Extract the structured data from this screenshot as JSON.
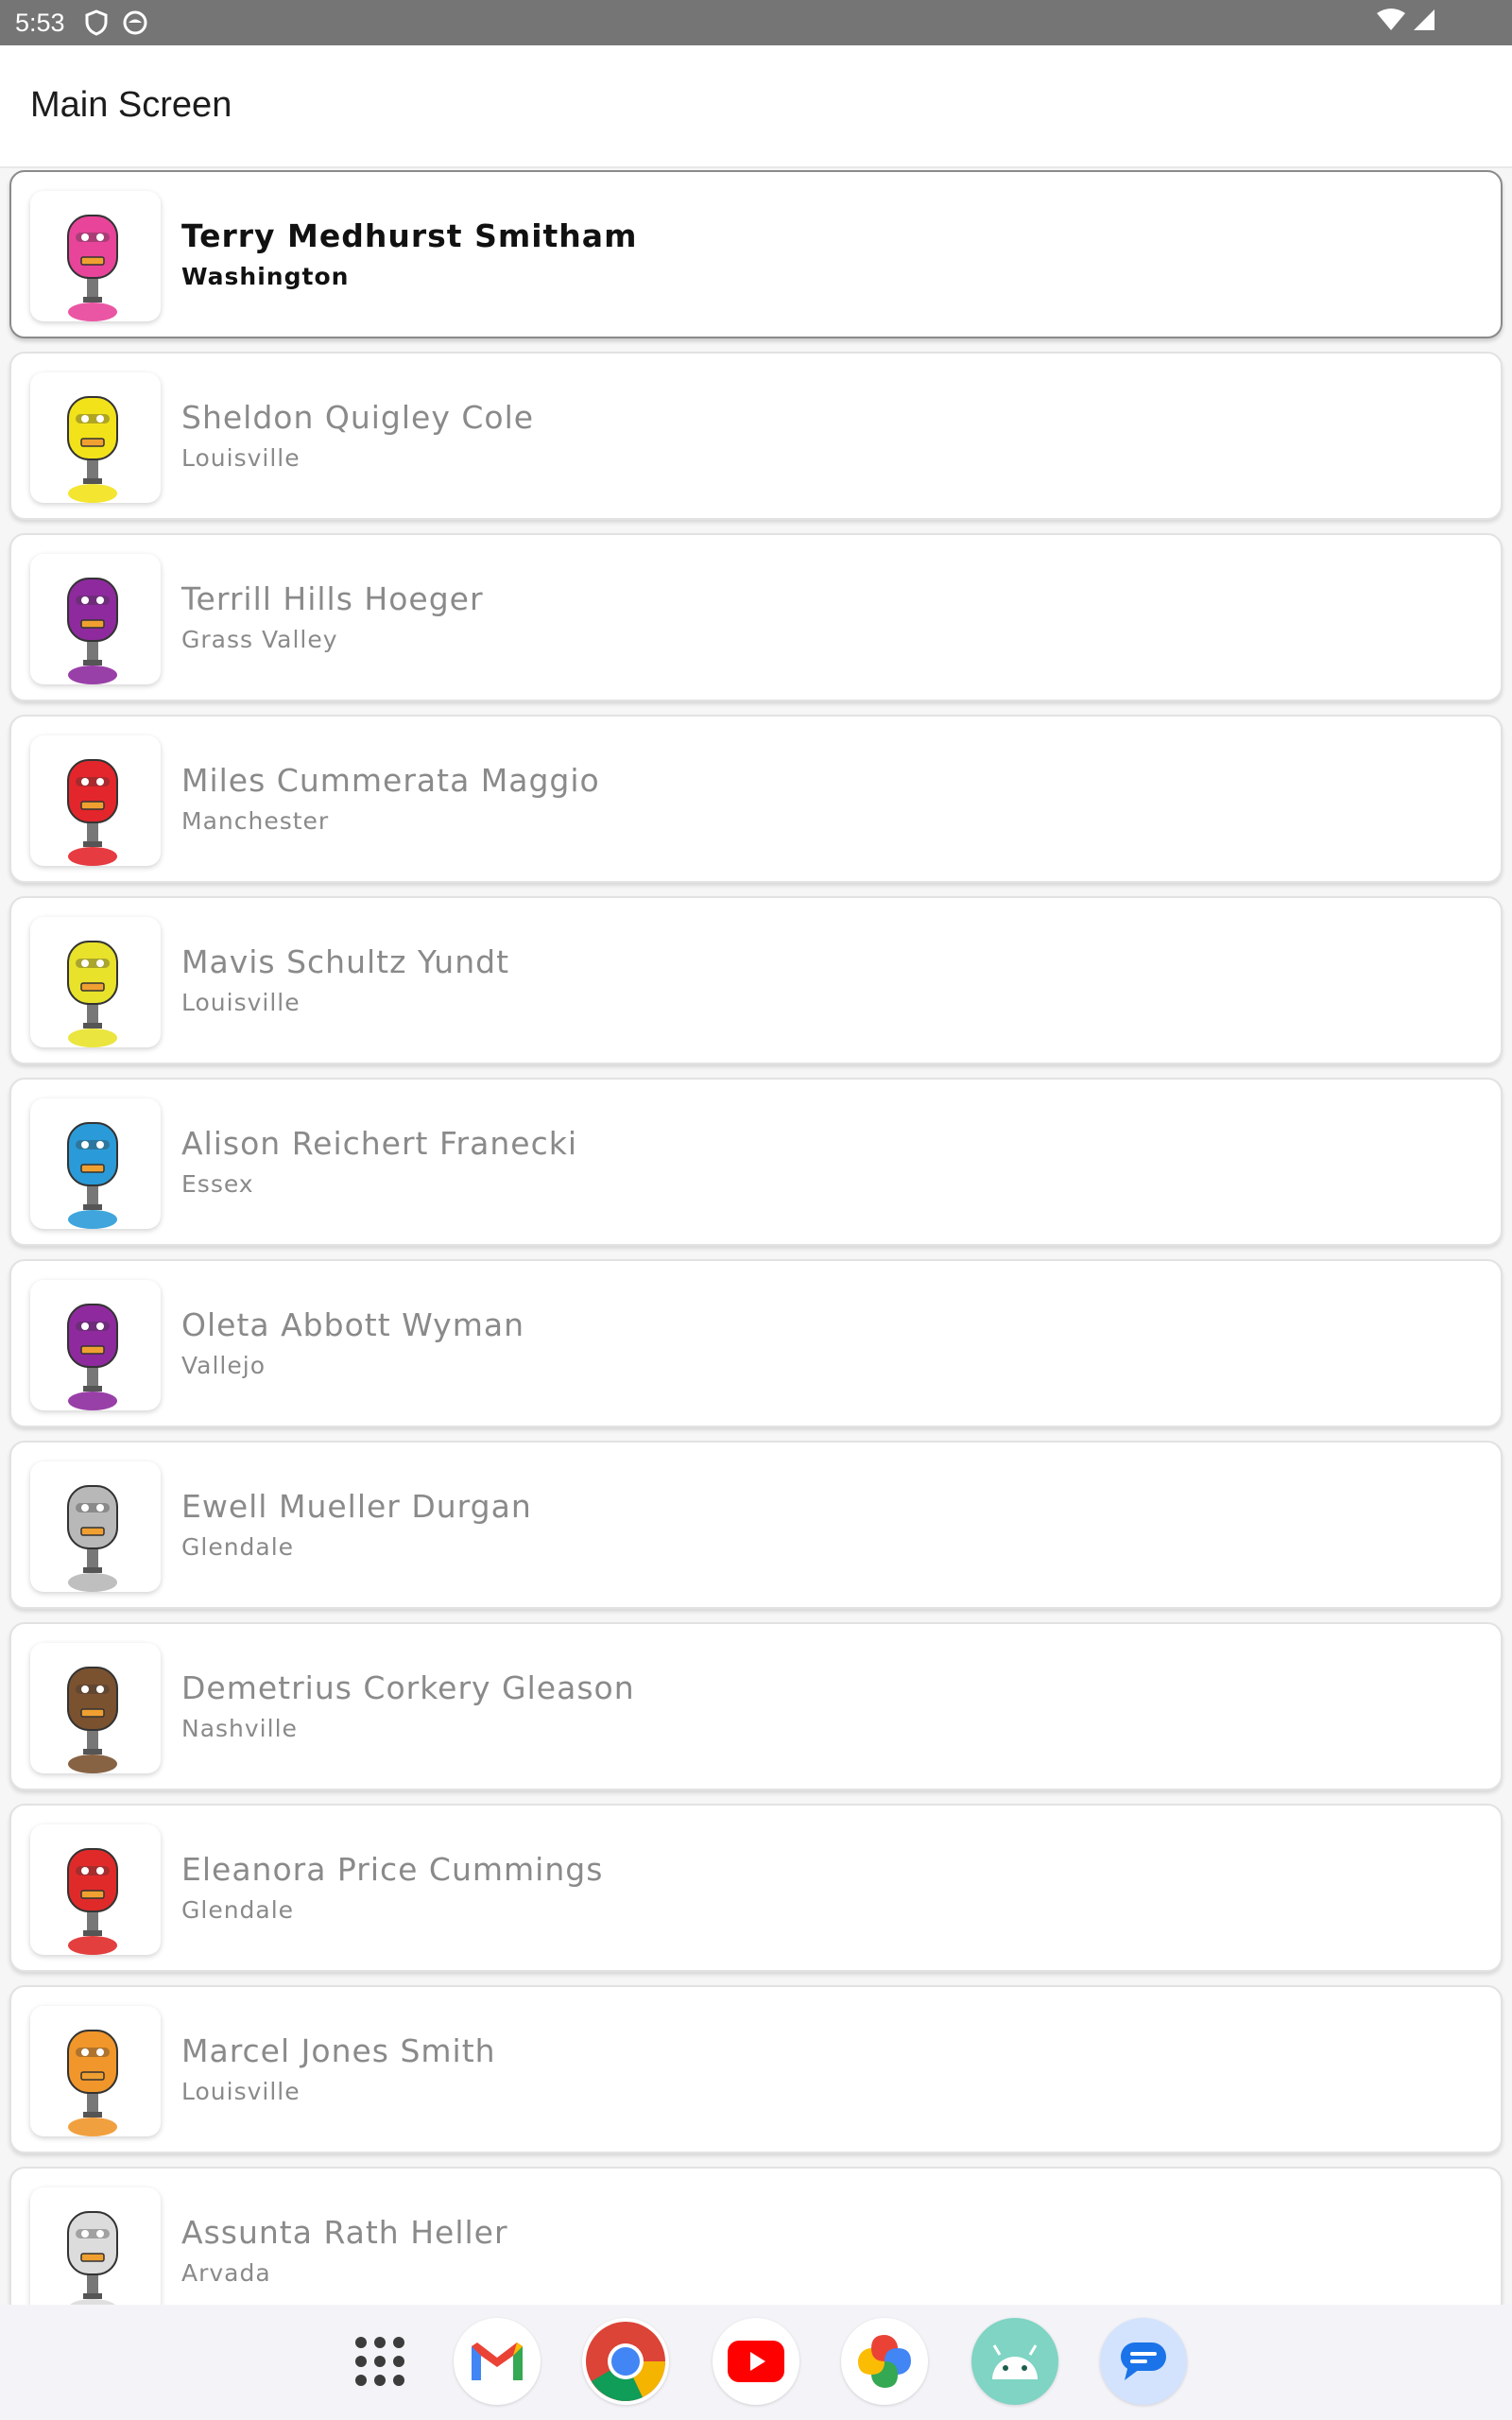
{
  "status_bar": {
    "time": "5:53",
    "left_icons": [
      "shield-icon",
      "face-icon"
    ],
    "right_icons": [
      "wifi-icon",
      "signal-icon"
    ]
  },
  "app_bar": {
    "title": "Main Screen"
  },
  "list": {
    "items": [
      {
        "name": "Terry Medhurst Smitham",
        "city": "Washington",
        "selected": true,
        "robot_color": "#e8449a"
      },
      {
        "name": "Sheldon Quigley Cole",
        "city": "Louisville",
        "selected": false,
        "robot_color": "#f2e21a"
      },
      {
        "name": "Terrill Hills Hoeger",
        "city": "Grass Valley",
        "selected": false,
        "robot_color": "#8e2a9e"
      },
      {
        "name": "Miles Cummerata Maggio",
        "city": "Manchester",
        "selected": false,
        "robot_color": "#e3262b"
      },
      {
        "name": "Mavis Schultz Yundt",
        "city": "Louisville",
        "selected": false,
        "robot_color": "#e8e22a"
      },
      {
        "name": "Alison Reichert Franecki",
        "city": "Essex",
        "selected": false,
        "robot_color": "#2a9bd8"
      },
      {
        "name": "Oleta Abbott Wyman",
        "city": "Vallejo",
        "selected": false,
        "robot_color": "#8e2a9e"
      },
      {
        "name": "Ewell Mueller Durgan",
        "city": "Glendale",
        "selected": false,
        "robot_color": "#b8b8b8"
      },
      {
        "name": "Demetrius Corkery Gleason",
        "city": "Nashville",
        "selected": false,
        "robot_color": "#7a5230"
      },
      {
        "name": "Eleanora Price Cummings",
        "city": "Glendale",
        "selected": false,
        "robot_color": "#e02a2a"
      },
      {
        "name": "Marcel Jones Smith",
        "city": "Louisville",
        "selected": false,
        "robot_color": "#f0962a"
      },
      {
        "name": "Assunta Rath Heller",
        "city": "Arvada",
        "selected": false,
        "robot_color": "#dcdcdc"
      }
    ]
  },
  "dock": {
    "apps": [
      "app-drawer-icon",
      "gmail-icon",
      "chrome-icon",
      "youtube-icon",
      "photos-icon",
      "android-studio-icon",
      "messages-icon"
    ]
  }
}
